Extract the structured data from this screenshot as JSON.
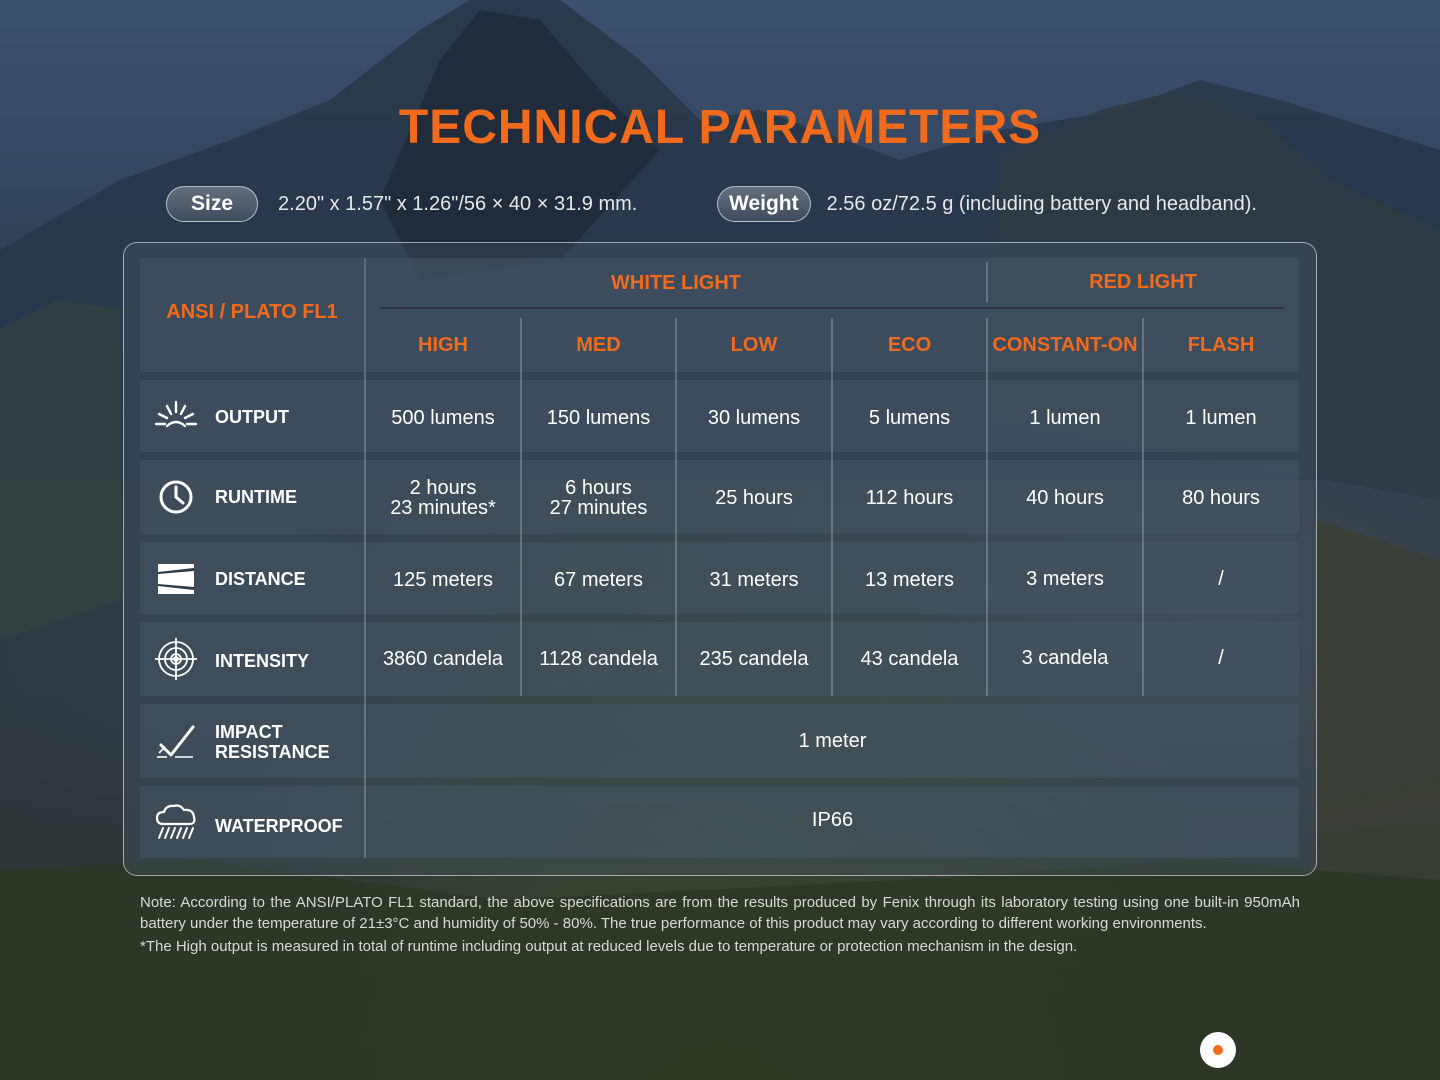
{
  "title": "TECHNICAL PARAMETERS",
  "specs": {
    "size_label": "Size",
    "size_value": "2.20\" x 1.57\" x 1.26\"/56 × 40 × 31.9 mm.",
    "weight_label": "Weight",
    "weight_value": "2.56 oz/72.5 g (including battery and headband)."
  },
  "table": {
    "corner": "ANSI / PLATO FL1",
    "groups": [
      "WHITE LIGHT",
      "RED LIGHT"
    ],
    "modes": [
      "HIGH",
      "MED",
      "LOW",
      "ECO",
      "CONSTANT-ON",
      "FLASH"
    ],
    "rows": [
      {
        "icon": "output-burst-icon",
        "label": "OUTPUT",
        "values": [
          "500 lumens",
          "150 lumens",
          "30 lumens",
          "5 lumens",
          "1 lumen",
          "1 lumen"
        ]
      },
      {
        "icon": "clock-icon",
        "label": "RUNTIME",
        "values": [
          [
            "2 hours",
            "23 minutes*"
          ],
          [
            "6 hours",
            "27 minutes"
          ],
          "25 hours",
          "112 hours",
          "40 hours",
          "80 hours"
        ]
      },
      {
        "icon": "distance-beam-icon",
        "label": "DISTANCE",
        "values": [
          "125 meters",
          "67 meters",
          "31 meters",
          "13 meters",
          "3 meters",
          "/"
        ]
      },
      {
        "icon": "target-intensity-icon",
        "label": "INTENSITY",
        "values": [
          "3860 candela",
          "1128 candela",
          "235 candela",
          "43 candela",
          "3 candela",
          "/"
        ]
      },
      {
        "icon": "impact-check-icon",
        "label_lines": [
          "IMPACT",
          "RESISTANCE"
        ],
        "span_value": "1 meter"
      },
      {
        "icon": "rain-cloud-icon",
        "label": "WATERPROOF",
        "span_value": "IP66"
      }
    ]
  },
  "notes": [
    "Note: According to the ANSI/PLATO FL1 standard, the above specifications are from the results produced by Fenix through its laboratory testing using one built-in 950mAh battery under the temperature of 21±3°C and humidity of 50% - 80%. The true performance of this product may vary according to different working environments.",
    "*The High output is measured in total of runtime including output at reduced levels due to temperature or protection mechanism in the design."
  ],
  "colors": {
    "accent": "#f26a1b",
    "text": "#ffffff"
  }
}
